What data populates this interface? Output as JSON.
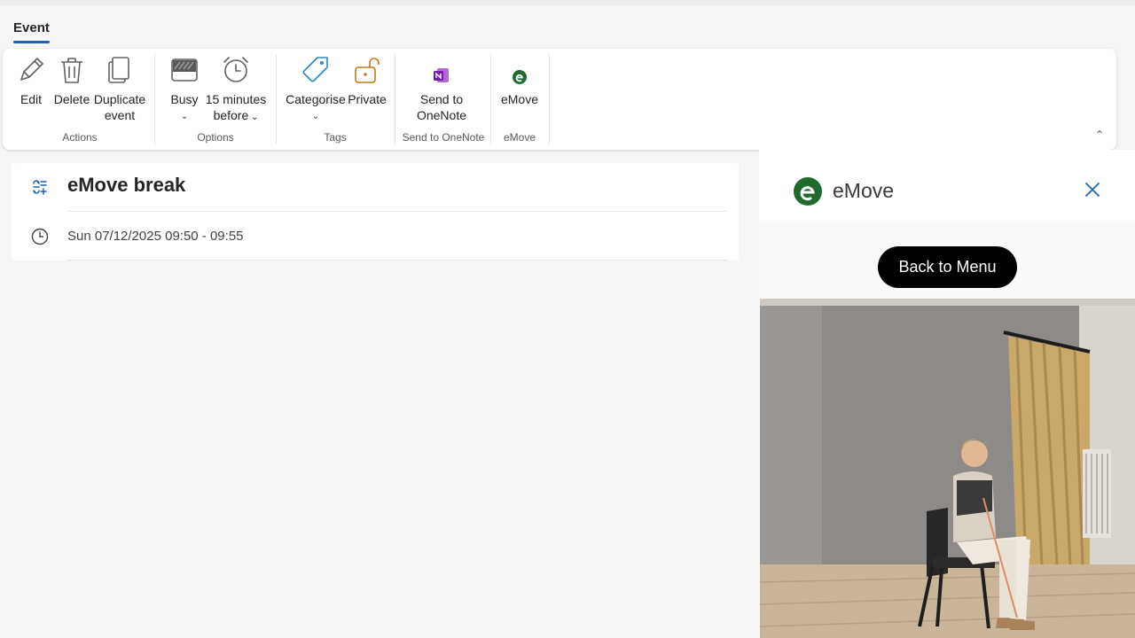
{
  "tabs": {
    "event_label": "Event"
  },
  "ribbon": {
    "actions": {
      "edit_label": "Edit",
      "delete_label": "Delete",
      "duplicate_line1": "Duplicate",
      "duplicate_line2": "event",
      "group_label": "Actions"
    },
    "options": {
      "busy_label": "Busy",
      "reminder_line1": "15 minutes",
      "reminder_line2": "before",
      "group_label": "Options"
    },
    "tags": {
      "categorise_label": "Categorise",
      "private_label": "Private",
      "group_label": "Tags"
    },
    "onenote": {
      "send_line1": "Send to",
      "send_line2": "OneNote",
      "group_label": "Send to OneNote"
    },
    "emove": {
      "button_label": "eMove",
      "group_label": "eMove"
    }
  },
  "event": {
    "title": "eMove break",
    "datetime": "Sun 07/12/2025 09:50 - 09:55"
  },
  "side_pane": {
    "title": "eMove",
    "back_button_label": "Back to Menu"
  },
  "colors": {
    "accent_blue": "#1f5fb8",
    "emove_green": "#1e6b2c",
    "onenote_purple": "#7719aa",
    "private_orange": "#c57a16",
    "tag_blue": "#2a84d6"
  },
  "icons": {
    "edit": "pencil-icon",
    "delete": "trash-icon",
    "duplicate": "copy-icon",
    "busy": "busy-status-icon",
    "reminder": "alarm-clock-icon",
    "categorise": "tag-icon",
    "private": "lock-open-icon",
    "onenote": "onenote-icon",
    "emove": "emove-logo-icon",
    "event_type": "recurring-event-icon",
    "time": "clock-icon",
    "close": "close-icon"
  }
}
